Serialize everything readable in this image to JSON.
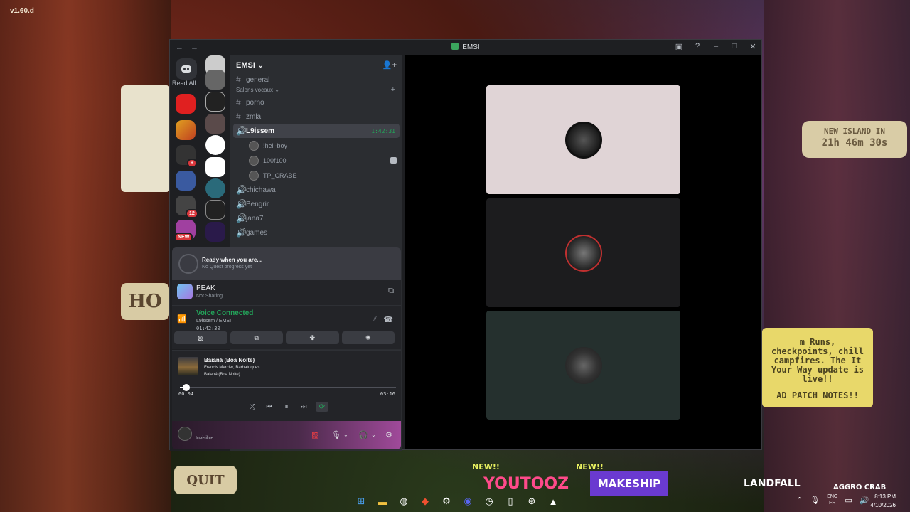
{
  "wallpaper": {
    "version": "v1.60.d",
    "island_line1": "NEW ISLAND IN",
    "island_line2": "21h 46m 30s",
    "patch_text": "m Runs, checkpoints, chill campfires. The It Your Way update is live!!",
    "patch_cta": "AD PATCH NOTES!!",
    "sign_ho": "HO",
    "sign_quit": "QUIT",
    "new_tag": "NEW!!",
    "brand_youtooz": "YOUTOOZ",
    "brand_makeship": "MAKESHIP",
    "brand_landfall": "LANDFALL",
    "brand_aggro": "AGGRO CRAB"
  },
  "window": {
    "title": "EMSI",
    "back": "←",
    "forward": "→",
    "ctrl_inbox": "▣",
    "ctrl_help": "?",
    "ctrl_min": "–",
    "ctrl_max": "□",
    "ctrl_close": "✕"
  },
  "guilds": {
    "home_label": "Read All",
    "badge_9": "9",
    "badge_12": "12",
    "badge_new": "NEW"
  },
  "server": {
    "name": "EMSI ⌄",
    "invite_icon": "👤+"
  },
  "channels": {
    "top_text": "general",
    "voice_category": "Salons vocaux ⌄",
    "add": "+",
    "text_channels": [
      "porno",
      "zmla"
    ],
    "active_voice": "L9issem",
    "active_timer": "1:42:31",
    "voice_users": [
      "!hell-boy",
      "100f100",
      "TP_CRABE"
    ],
    "voice_channels": [
      "chichawa",
      "Bengrir",
      "jana7",
      "games"
    ]
  },
  "quest": {
    "title": "Ready when you are...",
    "subtitle": "No Quest progress yet"
  },
  "activity": {
    "game": "PEAK",
    "status": "Not Sharing"
  },
  "voice": {
    "status": "Voice Connected",
    "location": "L9issem / EMSI",
    "time": "01:42:30"
  },
  "music": {
    "title": "Baianá (Boa Noite)",
    "artists": "Francis Mercier, Barbatuques",
    "album": "Baianá (Boa Noite)",
    "elapsed": "00:04",
    "duration": "03:16",
    "progress_fraction": 0.02
  },
  "user": {
    "status": "Invisible"
  },
  "taskbar": {
    "lang_line1": "ENG",
    "lang_line2": "FR",
    "time": "8:13 PM",
    "date": "4/10/2026"
  }
}
